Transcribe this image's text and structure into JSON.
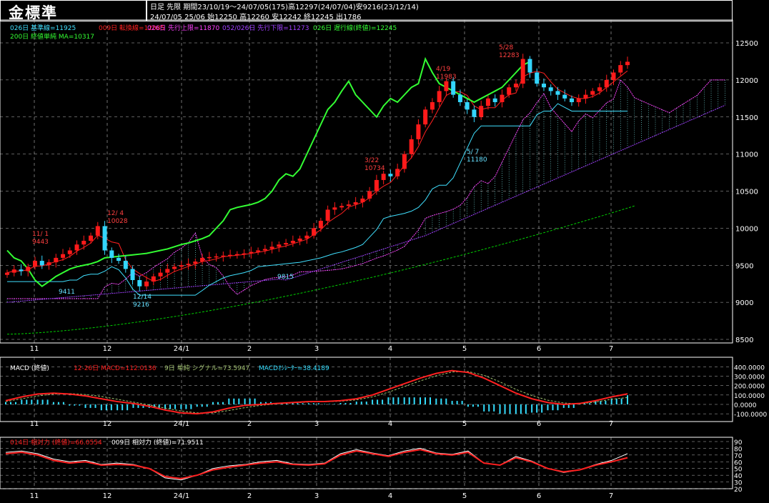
{
  "header": {
    "title": "金標準",
    "info_line1": "日足  先限  期間23/10/19～24/07/05(175)高12297(24/07/04)安9216(23/12/14)",
    "info_line2": "24/07/05 25/06  始12250  高12260  安12242  終12245  出1786"
  },
  "legend": {
    "kijun": "026日 基準線=11925",
    "tenkan": "009日 転換線=12085",
    "senkou_a": "026日 先行上限=11870",
    "senkou_b": "052/026日 先行下限=11273",
    "chikou": "026日 遅行線(終値)=12245",
    "ma200": "200日 終値単純 MA=10317"
  },
  "colors": {
    "background": "#000000",
    "up_candle": "#ff1a1a",
    "down_candle": "#33d6ff",
    "tenkan": "#ff2020",
    "kijun": "#40e0ff",
    "senkou_a": "#ff40ff",
    "senkou_b": "#a040ff",
    "chikou": "#33ff33",
    "ma200": "#00d000",
    "macd": "#ff2020",
    "signal": "#a0c070",
    "osc": "#33ddff",
    "rsi14": "#ff2020",
    "rsi9": "#ffffff",
    "grid": "#bbbbbb"
  },
  "price_axis": [
    "12500",
    "12000",
    "11500",
    "11000",
    "10500",
    "10000",
    "9500",
    "9000",
    "8500"
  ],
  "x_months": [
    "11",
    "12",
    "24/1",
    "2",
    "3",
    "4",
    "5",
    "6",
    "7"
  ],
  "annotations": [
    {
      "date": "11/ 1",
      "price": "9443"
    },
    {
      "date": "12/ 4",
      "price": "10028"
    },
    {
      "date": "3/22",
      "price": "10734"
    },
    {
      "date": "4/19",
      "price": "11983"
    },
    {
      "date": "5/ 7",
      "price": "11180"
    },
    {
      "date": "5/28",
      "price": "12283"
    },
    {
      "date": "12/14",
      "price": "9216"
    },
    {
      "price": "9411"
    },
    {
      "price": "9815"
    }
  ],
  "macd_panel": {
    "label_name": "MACD (終値)",
    "label_macd": "12-26日 MACD=112.0136",
    "label_signal": "9日 単純 シグナル=73.5947",
    "label_osc": "MACDｵｼﾚｰﾀｰ=38.4189",
    "axis": [
      "400.0000",
      "300.0000",
      "200.0000",
      "100.0000",
      "0.0000",
      "-100.0000"
    ]
  },
  "rsi_panel": {
    "label_14": "014日 相対力 (終値)=66.0554",
    "label_9": "009日 相対力 (終値)=71.9511",
    "axis": [
      "90",
      "80",
      "70",
      "60",
      "50",
      "40",
      "30",
      "20"
    ]
  },
  "chart_data": [
    {
      "type": "candlestick",
      "title": "金標準",
      "ylim": [
        8500,
        12700
      ],
      "x_months": [
        "11",
        "12",
        "24/1",
        "2",
        "3",
        "4",
        "5",
        "6",
        "7"
      ],
      "close_approx": [
        9400,
        9443,
        9420,
        9480,
        9560,
        9500,
        9540,
        9600,
        9650,
        9700,
        9780,
        9830,
        9900,
        10028,
        9700,
        9600,
        9560,
        9450,
        9300,
        9216,
        9280,
        9350,
        9400,
        9450,
        9480,
        9500,
        9520,
        9550,
        9600,
        9610,
        9620,
        9630,
        9640,
        9650,
        9660,
        9680,
        9700,
        9720,
        9750,
        9780,
        9800,
        9830,
        9860,
        9900,
        10000,
        10100,
        10250,
        10280,
        10300,
        10320,
        10350,
        10400,
        10500,
        10650,
        10734,
        10700,
        10800,
        11000,
        11200,
        11400,
        11600,
        11700,
        11850,
        11983,
        11800,
        11700,
        11600,
        11500,
        11650,
        11750,
        11700,
        11800,
        11900,
        11950,
        12283,
        12100,
        11950,
        11900,
        11850,
        11800,
        11750,
        11700,
        11750,
        11800,
        11850,
        11900,
        12000,
        12100,
        12200,
        12245
      ],
      "series": [
        {
          "name": "026日 基準線",
          "last": 11925
        },
        {
          "name": "009日 転換線",
          "last": 12085
        },
        {
          "name": "026日 先行上限",
          "last": 11870
        },
        {
          "name": "052/026日 先行下限",
          "last": 11273
        },
        {
          "name": "026日 遅行線(終値)",
          "last": 12245
        },
        {
          "name": "200日 終値単純 MA",
          "last": 10317
        }
      ]
    },
    {
      "type": "line",
      "title": "MACD (終値)",
      "ylim": [
        -150,
        420
      ],
      "series": [
        {
          "name": "12-26日 MACD",
          "values": [
            40,
            80,
            110,
            120,
            110,
            90,
            60,
            30,
            10,
            -20,
            -60,
            -90,
            -100,
            -80,
            -40,
            -10,
            0,
            10,
            20,
            30,
            30,
            40,
            60,
            100,
            160,
            220,
            280,
            330,
            360,
            340,
            280,
            200,
            120,
            60,
            20,
            0,
            10,
            40,
            80,
            112
          ]
        },
        {
          "name": "9日 単純 シグナル",
          "values": [
            30,
            60,
            90,
            110,
            115,
            105,
            85,
            55,
            25,
            -5,
            -40,
            -70,
            -90,
            -90,
            -65,
            -35,
            -10,
            5,
            15,
            25,
            28,
            34,
            48,
            80,
            130,
            190,
            250,
            305,
            345,
            350,
            310,
            240,
            160,
            95,
            45,
            15,
            5,
            25,
            55,
            73
          ]
        }
      ]
    },
    {
      "type": "line",
      "title": "相対力",
      "ylim": [
        20,
        90
      ],
      "series": [
        {
          "name": "014日 相対力 (終値)",
          "values": [
            72,
            74,
            70,
            62,
            58,
            60,
            55,
            56,
            55,
            50,
            38,
            35,
            40,
            48,
            52,
            55,
            58,
            60,
            56,
            55,
            57,
            70,
            76,
            72,
            68,
            74,
            78,
            72,
            70,
            74,
            58,
            55,
            66,
            60,
            50,
            45,
            48,
            55,
            60,
            66
          ]
        },
        {
          "name": "009日 相対力 (終値)",
          "values": [
            74,
            76,
            72,
            64,
            60,
            62,
            56,
            58,
            56,
            50,
            36,
            33,
            40,
            50,
            54,
            56,
            60,
            62,
            57,
            56,
            58,
            72,
            78,
            73,
            69,
            76,
            80,
            73,
            71,
            76,
            58,
            55,
            68,
            61,
            50,
            44,
            48,
            56,
            62,
            72
          ]
        }
      ]
    }
  ]
}
